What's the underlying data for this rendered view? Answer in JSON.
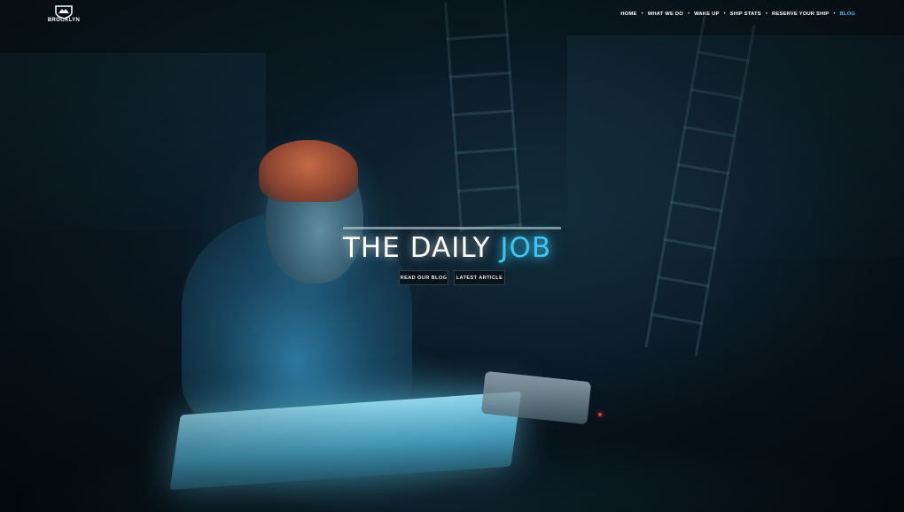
{
  "logo": {
    "text": "BROOKLYN",
    "icon": "shield-mountain-icon"
  },
  "nav": {
    "items": [
      {
        "label": "HOME",
        "active": false
      },
      {
        "label": "WHAT WE DO",
        "active": false
      },
      {
        "label": "WAKE UP",
        "active": false
      },
      {
        "label": "SHIP STATS",
        "active": false
      },
      {
        "label": "RESERVE YOUR SHIP",
        "active": false
      },
      {
        "label": "BLOG",
        "active": true
      }
    ],
    "separator": "•"
  },
  "hero": {
    "title_main": "THE DAILY ",
    "title_accent": "JOB",
    "buttons": {
      "read_blog": "READ OUR BLOG",
      "latest_article": "LATEST ARTICLE"
    }
  },
  "colors": {
    "accent": "#3ec7ee",
    "text": "#ffffff",
    "background": "#0a1822"
  }
}
